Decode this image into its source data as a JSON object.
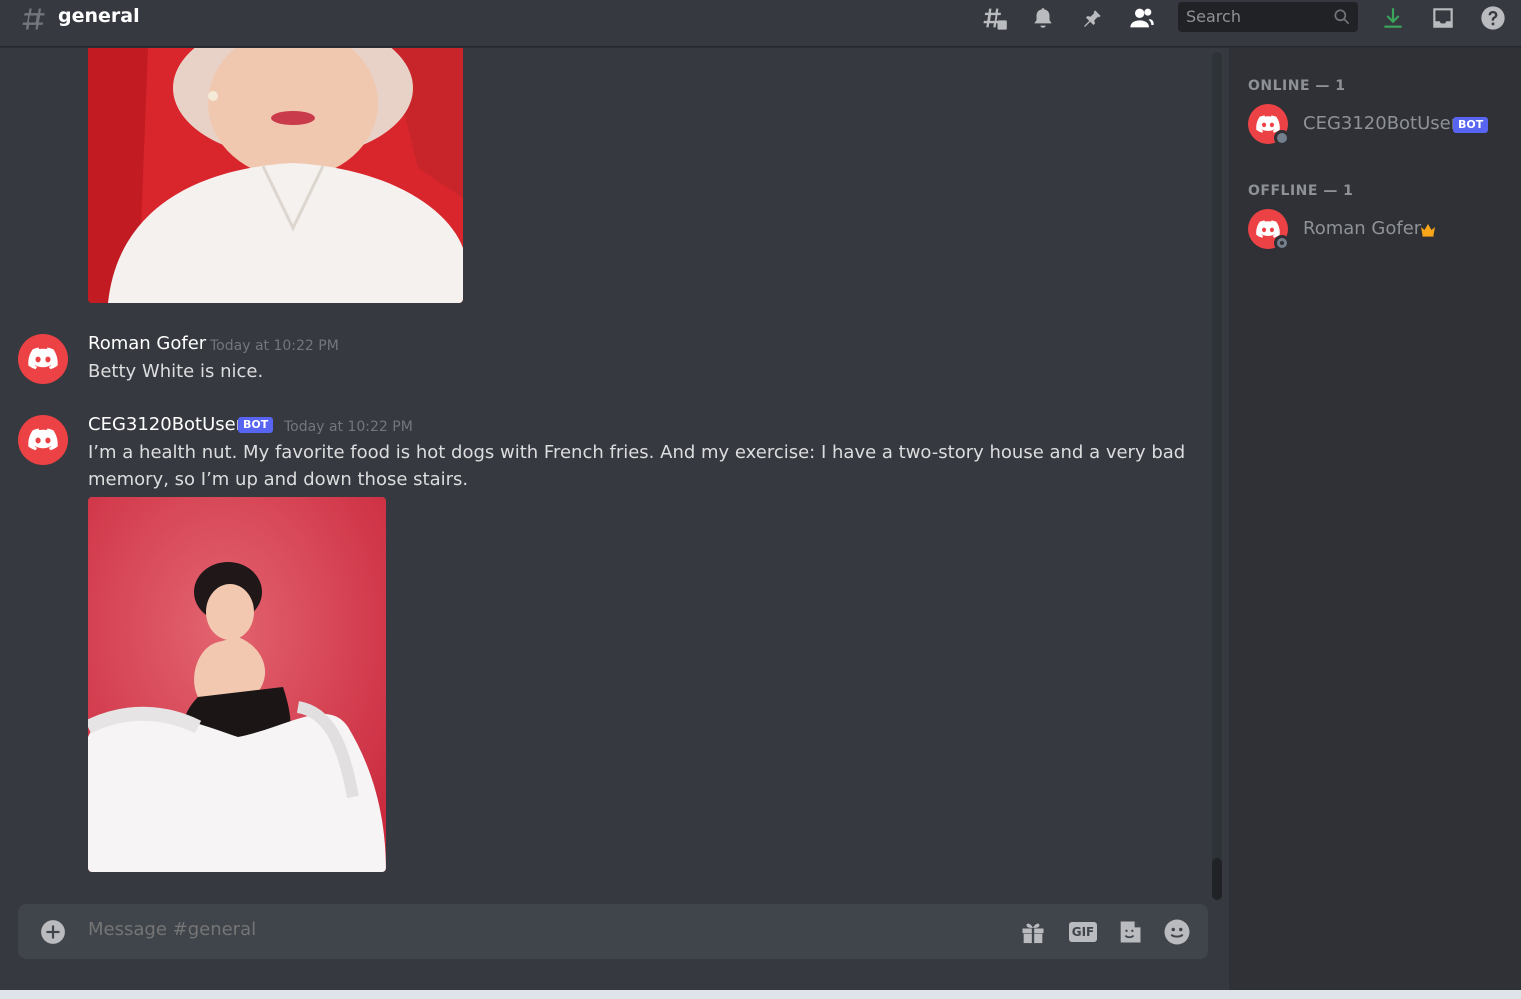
{
  "header": {
    "channel_name": "general",
    "search_placeholder": "Search"
  },
  "messages": [
    {
      "author": "Roman Gofer",
      "timestamp": "Today at 10:22 PM",
      "text": "Betty White is nice."
    },
    {
      "author": "CEG3120BotUser",
      "bot_tag": "BOT",
      "timestamp": "Today at 10:22 PM",
      "text_line1": "I’m a health nut. My favorite food is hot dogs with French fries. And my exercise: I have a two-story house and a very bad",
      "text_line2": "memory, so I’m up and down those stairs."
    }
  ],
  "composer": {
    "placeholder": "Message #general",
    "gif_label": "GIF"
  },
  "members": {
    "online_header": "ONLINE — 1",
    "offline_header": "OFFLINE — 1",
    "online": [
      {
        "name": "CEG3120BotUser",
        "tag": "BOT"
      }
    ],
    "offline": [
      {
        "name": "Roman Gofer"
      }
    ]
  },
  "colors": {
    "background": "#36393f",
    "sidebar": "#2f3136",
    "avatar": "#ed4245",
    "bot_tag": "#5865f2",
    "crown": "#faa61a"
  }
}
